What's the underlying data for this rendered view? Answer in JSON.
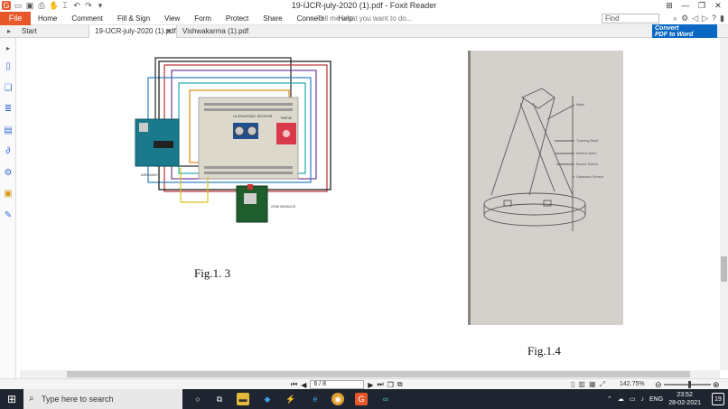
{
  "window": {
    "title": "19-IJCR-july-2020 (1).pdf - Foxit Reader"
  },
  "menu": {
    "file": "File",
    "items": [
      "Home",
      "Comment",
      "Fill & Sign",
      "View",
      "Form",
      "Protect",
      "Share",
      "Connect",
      "Help"
    ],
    "tellme": "Tell me what you want to do..."
  },
  "find": {
    "placeholder": "Find"
  },
  "tabs": {
    "start": "Start",
    "active": "19-IJCR-july-2020 (1).pdf",
    "other": "Vishwakarma (1).pdf"
  },
  "convert": {
    "line1": "Convert",
    "line2": "PDF to Word"
  },
  "page": {
    "fig13_caption": "Fig.1. 3",
    "fig14_caption": "Fig.1.4",
    "diagram_labels": {
      "arduino": "ARDUINO",
      "ultrasonic": "ULTRASONIC SENSOR",
      "tmp": "TMP36",
      "gsm": "GSM MODULE"
    },
    "sketch_labels": [
      "Mask",
      "Tracking Band",
      "Electric Band",
      "Buzzer Switch",
      "Ultrasonic Sensor"
    ]
  },
  "status": {
    "page_indicator": "6 / 8",
    "zoom": "142.75%"
  },
  "taskbar": {
    "search_placeholder": "Type here to search",
    "lang": "ENG",
    "time": "23:52",
    "date": "28-02-2021",
    "notifications": "19"
  },
  "colors": {
    "accent": "#e8572a",
    "taskbar": "#1f2530",
    "convert": "#0a67c2"
  }
}
